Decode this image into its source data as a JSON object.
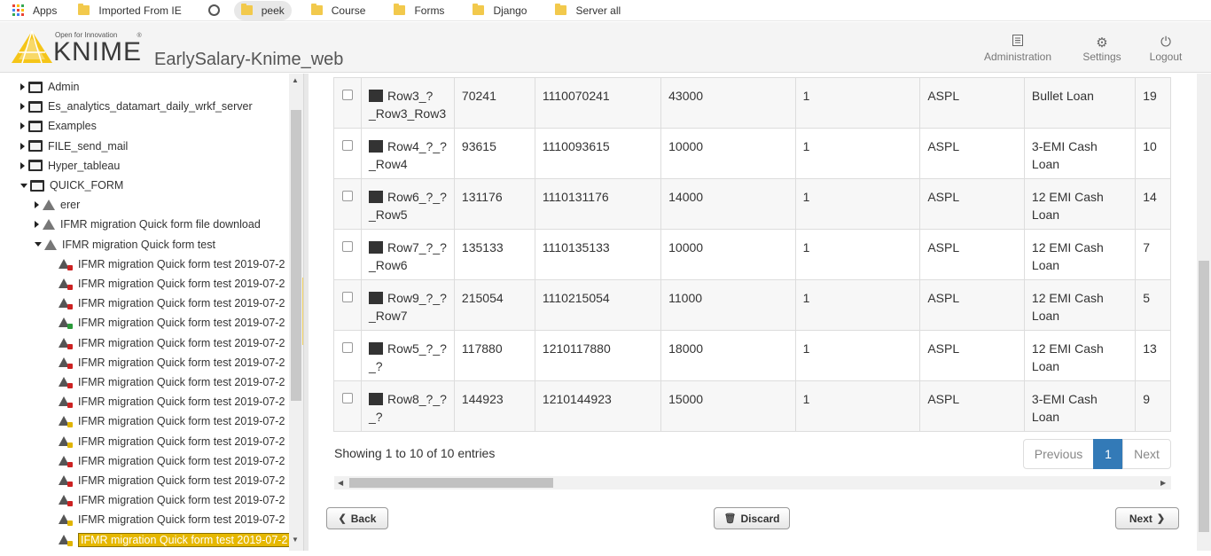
{
  "bookmarks": [
    {
      "label": "Apps",
      "icon": "apps-icon"
    },
    {
      "label": "Imported From IE",
      "icon": "folder-icon"
    },
    {
      "label": "",
      "icon": "globe-icon"
    },
    {
      "label": "peek",
      "icon": "folder-icon",
      "active": true
    },
    {
      "label": "Course",
      "icon": "folder-icon"
    },
    {
      "label": "Forms",
      "icon": "folder-icon"
    },
    {
      "label": "Django",
      "icon": "folder-icon"
    },
    {
      "label": "Server all",
      "icon": "folder-icon"
    }
  ],
  "header": {
    "logo_tagline": "Open for Innovation",
    "logo_text": "KNIME",
    "logo_reg": "®",
    "app_title": "EarlySalary-Knime_web",
    "buttons": [
      {
        "label": "Administration",
        "icon": "list-icon"
      },
      {
        "label": "Settings",
        "icon": "gear-icon"
      },
      {
        "label": "Logout",
        "icon": "power-icon"
      }
    ]
  },
  "tree": {
    "folders": [
      {
        "label": "Admin",
        "expanded": false
      },
      {
        "label": "Es_analytics_datamart_daily_wrkf_server",
        "expanded": false
      },
      {
        "label": "Examples",
        "expanded": false
      },
      {
        "label": "FILE_send_mail",
        "expanded": false
      },
      {
        "label": "Hyper_tableau",
        "expanded": false
      },
      {
        "label": "QUICK_FORM",
        "expanded": true
      }
    ],
    "workflows": [
      {
        "label": "erer",
        "expanded": false
      },
      {
        "label": "IFMR migration Quick form file download",
        "expanded": false
      },
      {
        "label": "IFMR migration Quick form test",
        "expanded": true
      }
    ],
    "jobs": [
      {
        "label": "IFMR migration Quick form test 2019-07-2",
        "status_color": "#cc2222"
      },
      {
        "label": "IFMR migration Quick form test 2019-07-2",
        "status_color": "#cc2222"
      },
      {
        "label": "IFMR migration Quick form test 2019-07-2",
        "status_color": "#cc2222"
      },
      {
        "label": "IFMR migration Quick form test 2019-07-2",
        "status_color": "#2a9a3a"
      },
      {
        "label": "IFMR migration Quick form test 2019-07-2",
        "status_color": "#cc2222"
      },
      {
        "label": "IFMR migration Quick form test 2019-07-2",
        "status_color": "#cc2222"
      },
      {
        "label": "IFMR migration Quick form test 2019-07-2",
        "status_color": "#cc2222"
      },
      {
        "label": "IFMR migration Quick form test 2019-07-2",
        "status_color": "#cc2222"
      },
      {
        "label": "IFMR migration Quick form test 2019-07-2",
        "status_color": "#e0b400"
      },
      {
        "label": "IFMR migration Quick form test 2019-07-2",
        "status_color": "#e0b400"
      },
      {
        "label": "IFMR migration Quick form test 2019-07-2",
        "status_color": "#cc2222"
      },
      {
        "label": "IFMR migration Quick form test 2019-07-2",
        "status_color": "#cc2222"
      },
      {
        "label": "IFMR migration Quick form test 2019-07-2",
        "status_color": "#cc2222"
      },
      {
        "label": "IFMR migration Quick form test 2019-07-2",
        "status_color": "#e0b400"
      },
      {
        "label": "IFMR migration Quick form test 2019-07-2",
        "status_color": "#e0b400",
        "selected": true
      }
    ]
  },
  "table": {
    "rows": [
      {
        "row": "Row3_?\n_Row3_Row3",
        "c1": "70241",
        "c2": "1110070241",
        "c3": "43000",
        "c4": "1",
        "c5": "ASPL",
        "c6": "Bullet Loan",
        "c7": "19"
      },
      {
        "row": "Row4_?_?\n_Row4",
        "c1": "93615",
        "c2": "1110093615",
        "c3": "10000",
        "c4": "1",
        "c5": "ASPL",
        "c6": "3-EMI Cash Loan",
        "c7": "10"
      },
      {
        "row": "Row6_?_?\n_Row5",
        "c1": "131176",
        "c2": "1110131176",
        "c3": "14000",
        "c4": "1",
        "c5": "ASPL",
        "c6": "12 EMI Cash\nLoan",
        "c7": "14"
      },
      {
        "row": "Row7_?_?\n_Row6",
        "c1": "135133",
        "c2": "1110135133",
        "c3": "10000",
        "c4": "1",
        "c5": "ASPL",
        "c6": "12 EMI Cash\nLoan",
        "c7": "7"
      },
      {
        "row": "Row9_?_?\n_Row7",
        "c1": "215054",
        "c2": "1110215054",
        "c3": "11000",
        "c4": "1",
        "c5": "ASPL",
        "c6": "12 EMI Cash\nLoan",
        "c7": "5"
      },
      {
        "row": "Row5_?_?\n_?",
        "c1": "117880",
        "c2": "1210117880",
        "c3": "18000",
        "c4": "1",
        "c5": "ASPL",
        "c6": "12 EMI Cash\nLoan",
        "c7": "13"
      },
      {
        "row": "Row8_?_?\n_?",
        "c1": "144923",
        "c2": "1210144923",
        "c3": "15000",
        "c4": "1",
        "c5": "ASPL",
        "c6": "3-EMI Cash Loan",
        "c7": "9"
      }
    ]
  },
  "pagination": {
    "info": "Showing 1 to 10 of 10 entries",
    "previous": "Previous",
    "current": "1",
    "next": "Next"
  },
  "footer": {
    "back": "Back",
    "discard": "Discard",
    "next": "Next"
  },
  "colors": {
    "accent": "#337ab7",
    "selected": "#e6b800",
    "knime_yellow": "#f5c518"
  }
}
